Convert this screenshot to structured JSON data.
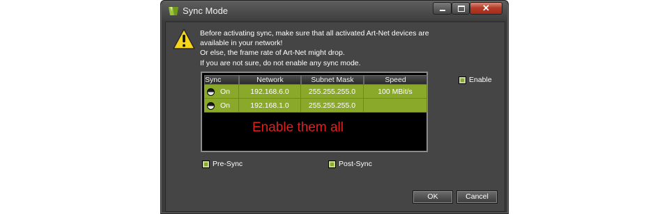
{
  "window": {
    "title": "Sync Mode",
    "controls": {
      "close_label": "✕"
    }
  },
  "message": {
    "lines": [
      "Before activating sync, make sure that all activated Art-Net devices are",
      "available in your network!",
      "Or else, the frame rate of Art-Net might drop.",
      "If you are not sure, do not enable any sync mode."
    ]
  },
  "table": {
    "headers": [
      "Sync",
      "Network",
      "Subnet Mask",
      "Speed"
    ],
    "rows": [
      {
        "sync": "On",
        "network": "192.168.6.0",
        "mask": "255.255.255.0",
        "speed": "100 MBit/s"
      },
      {
        "sync": "On",
        "network": "192.168.1.0",
        "mask": "255.255.255.0",
        "speed": ""
      }
    ],
    "annotation": "Enable them all"
  },
  "checkboxes": {
    "enable": {
      "label": "Enable",
      "checked": true
    },
    "pre_sync": {
      "label": "Pre-Sync",
      "checked": true
    },
    "post_sync": {
      "label": "Post-Sync",
      "checked": true
    }
  },
  "buttons": {
    "ok": "OK",
    "cancel": "Cancel"
  },
  "colors": {
    "accent_green": "#8aa92a",
    "annotation_red": "#e01f1f",
    "dialog_bg": "#454545"
  }
}
